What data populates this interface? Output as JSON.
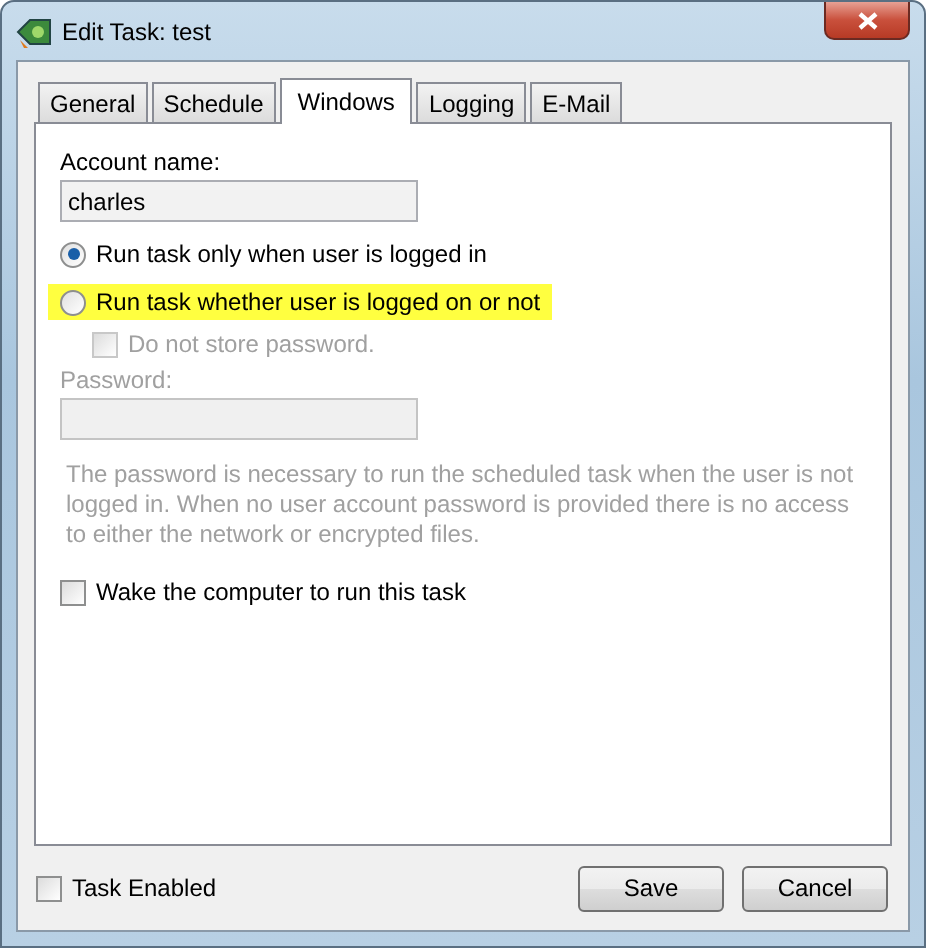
{
  "window": {
    "title": "Edit Task: test"
  },
  "tabs": [
    {
      "label": "General",
      "selected": false
    },
    {
      "label": "Schedule",
      "selected": false
    },
    {
      "label": "Windows",
      "selected": true
    },
    {
      "label": "Logging",
      "selected": false
    },
    {
      "label": "E-Mail",
      "selected": false
    }
  ],
  "account": {
    "label": "Account name:",
    "value": "charles"
  },
  "run_options": [
    {
      "label": "Run task only when user is logged in",
      "selected": true,
      "highlighted": false
    },
    {
      "label": "Run task whether user is logged on or not",
      "selected": false,
      "highlighted": true
    }
  ],
  "store_password": {
    "label": "Do not store password.",
    "checked": false,
    "disabled": true
  },
  "password": {
    "label": "Password:",
    "disabled": true
  },
  "note": {
    "text": "The password is necessary to run the scheduled task when the user is not logged in. When no user account password is provided there is no access to either the network or encrypted files.",
    "disabled": true
  },
  "wake": {
    "label": "Wake the computer to run this task",
    "checked": false
  },
  "task_enabled": {
    "label": "Task Enabled",
    "checked": false
  },
  "buttons": [
    "Save",
    "Cancel"
  ]
}
